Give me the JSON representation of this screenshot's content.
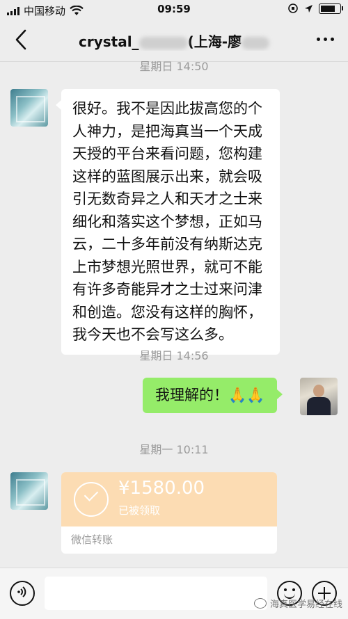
{
  "status_bar": {
    "carrier": "中国移动",
    "time": "09:59",
    "battery_level": 0.85
  },
  "nav": {
    "title_prefix": "crystal_",
    "title_suffix": "(上海-廖"
  },
  "messages": [
    {
      "type": "timestamp",
      "text": "星期日 14:50"
    },
    {
      "type": "text",
      "side": "left",
      "lines": [
        "很好。我不是因此拔高您的个",
        "人神力，是把海真当一个天成",
        "天授的平台来看问题，您构建",
        "这样的蓝图展示出来，就会吸",
        "引无数奇异之人和天才之士来",
        "细化和落实这个梦想，正如马",
        "云，二十多年前没有纳斯达克",
        "上市梦想光照世界，就可不能",
        "有许多奇能异才之士过来问津",
        "和创造。您没有这样的胸怀，",
        "我今天也不会写这么多。"
      ]
    },
    {
      "type": "timestamp",
      "text": "星期日 14:56"
    },
    {
      "type": "text",
      "side": "right",
      "text": "我理解的！🙏🙏"
    },
    {
      "type": "timestamp",
      "text": "星期一 10:11"
    },
    {
      "type": "transfer",
      "side": "left",
      "amount": "¥1580.00",
      "status": "已被领取",
      "footer": "微信转账"
    }
  ],
  "watermark": "海真医学易经在线",
  "icons": {
    "back": "chevron-left-icon",
    "more": "ellipsis-icon",
    "voice": "voice-icon",
    "emoji": "emoji-icon",
    "plus": "plus-icon"
  },
  "colors": {
    "background": "#ededed",
    "bubble_mine": "#95ec69",
    "bubble_theirs": "#ffffff",
    "transfer_card": "#fcdcb3"
  }
}
